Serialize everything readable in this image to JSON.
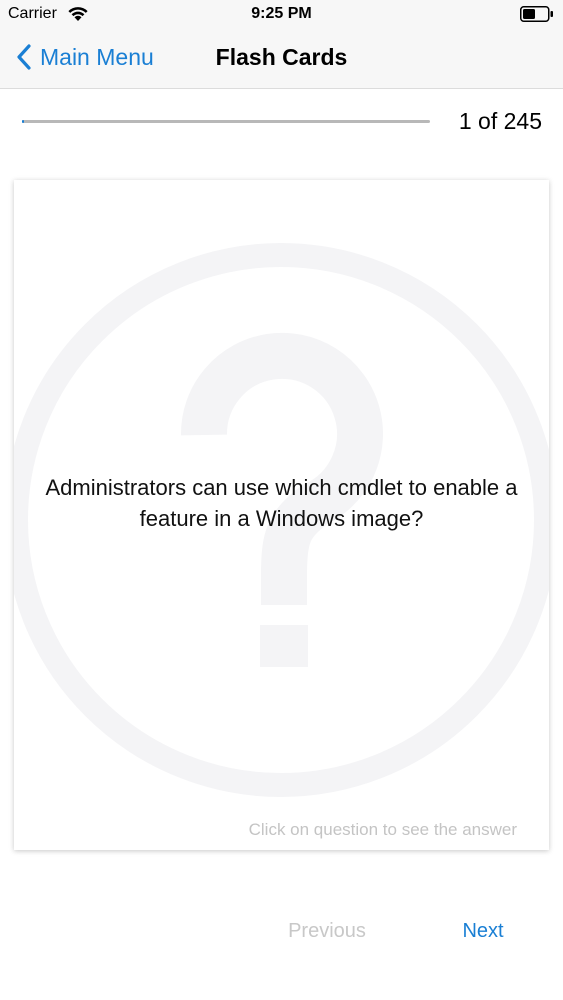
{
  "status_bar": {
    "carrier": "Carrier",
    "time": "9:25 PM",
    "battery_icon": "battery-half-icon",
    "wifi_icon": "wifi-icon"
  },
  "nav": {
    "back_label": "Main Menu",
    "back_icon": "chevron-left-icon",
    "title": "Flash Cards"
  },
  "progress": {
    "current": 1,
    "total": 245,
    "label": "1 of 245"
  },
  "card": {
    "question": "Administrators can use which cmdlet to enable a feature in a Windows image?",
    "hint": "Click on question to see the answer",
    "watermark_icon": "question-mark-icon"
  },
  "buttons": {
    "previous": "Previous",
    "next": "Next"
  },
  "colors": {
    "accent": "#1a7fd4",
    "disabled": "#c8c8c8",
    "hint": "#c4c4c4"
  }
}
